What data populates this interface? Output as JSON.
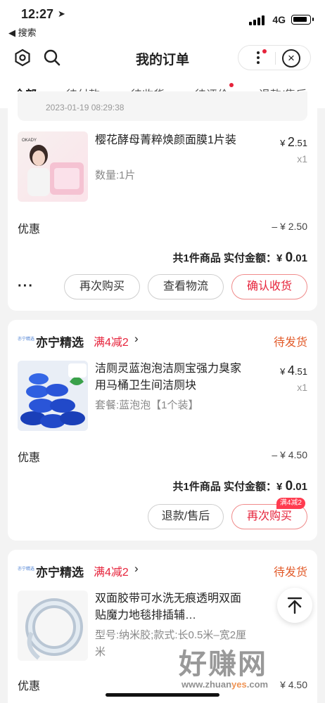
{
  "status_bar": {
    "time": "12:27",
    "back_label": "◀ 搜索",
    "network": "4G"
  },
  "header": {
    "title": "我的订单"
  },
  "tabs": [
    {
      "label": "全部",
      "active": true
    },
    {
      "label": "待付款",
      "active": false
    },
    {
      "label": "待收货",
      "active": false
    },
    {
      "label": "待评价",
      "active": false,
      "dot": true
    },
    {
      "label": "退款/售后",
      "active": false
    }
  ],
  "orders": [
    {
      "timestamp": "2023-01-19 08:29:38",
      "item": {
        "title": "樱花酵母菁粹焕颜面膜1片装",
        "spec": "数量:1片",
        "price_int": "2",
        "price_dec": ".51",
        "qty": "x1"
      },
      "discount_label": "优惠",
      "discount_value": "– ¥ 2.50",
      "total_prefix": "共1件商品  实付金额：",
      "total_currency": "¥ ",
      "total_int": "0",
      "total_dec": ".01",
      "more": "···",
      "buttons": [
        "再次购买",
        "查看物流",
        "确认收货"
      ]
    },
    {
      "store": "亦宁精选",
      "store_logo_text": "亦宁精选",
      "promo": "满4减2",
      "status": "待发货",
      "item": {
        "title": "洁厕灵蓝泡泡洁厕宝强力臭家用马桶卫生间洁厕块",
        "spec": "套餐:蓝泡泡【1个装】",
        "price_int": "4",
        "price_dec": ".51",
        "qty": "x1"
      },
      "discount_label": "优惠",
      "discount_value": "– ¥ 4.50",
      "total_prefix": "共1件商品  实付金额：",
      "total_currency": "¥ ",
      "total_int": "0",
      "total_dec": ".01",
      "buttons": [
        "退款/售后",
        "再次购买"
      ],
      "button_badge": "满4减2"
    },
    {
      "store": "亦宁精选",
      "store_logo_text": "亦宁精选",
      "promo": "满4减2",
      "status": "待发货",
      "item": {
        "title": "双面胶带可水洗无痕透明双面贴魔力地毯排插辅…",
        "spec": "型号:纳米胶;款式:长0.5米–宽2厘米",
        "price_partial": "¥"
      },
      "discount_label": "优惠",
      "discount_value": "¥ 4.50"
    }
  ],
  "watermark": {
    "text": "好赚网",
    "url_pre": "www.zhuan",
    "url_mid": "yes",
    "url_post": ".com"
  },
  "colors": {
    "accent_blue": "#1f4ee6",
    "promo_red": "#e6233b",
    "status_orange": "#e25b2a"
  }
}
